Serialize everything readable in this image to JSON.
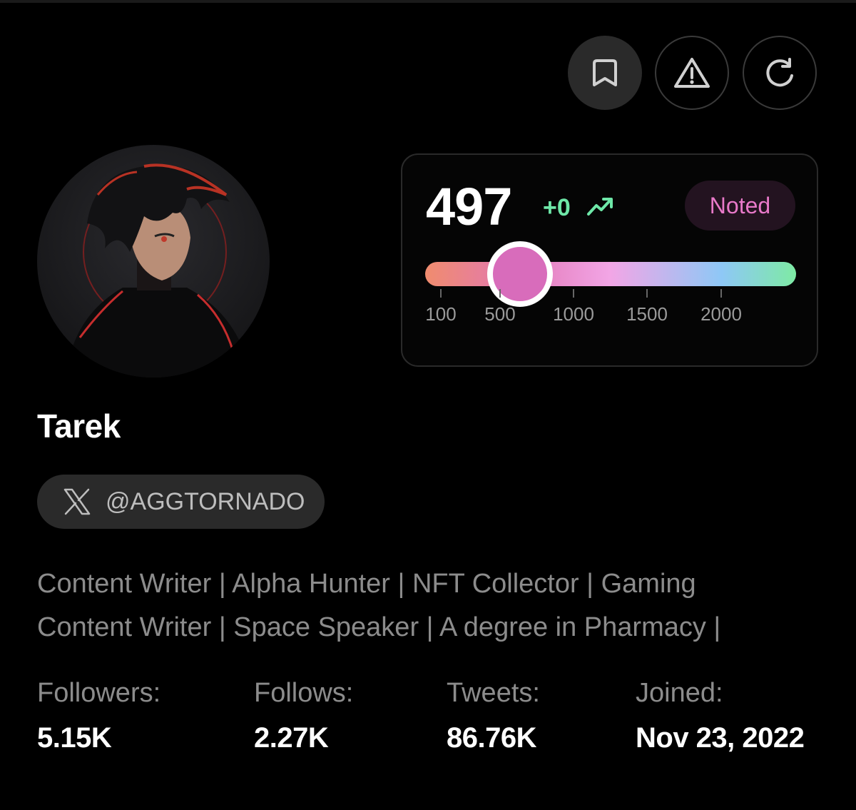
{
  "actions": {
    "bookmark_icon": "bookmark-icon",
    "report_icon": "warning-icon",
    "refresh_icon": "refresh-icon"
  },
  "score": {
    "value": "497",
    "delta": "+0",
    "badge": "Noted",
    "slider_value": 497,
    "scale_ticks": [
      "100",
      "500",
      "1000",
      "1500",
      "2000"
    ],
    "colors": {
      "delta": "#6ee7a8",
      "badge_text": "#e879c9",
      "thumb": "#d86cbb"
    }
  },
  "profile": {
    "name": "Tarek",
    "handle": "@AGGTORNADO",
    "bio": [
      "Content Writer | Alpha Hunter | NFT Collector | Gaming",
      "Content Writer | Space Speaker | A degree in Pharmacy |"
    ]
  },
  "stats": [
    {
      "label": "Followers:",
      "value": "5.15K"
    },
    {
      "label": "Follows:",
      "value": "2.27K"
    },
    {
      "label": "Tweets:",
      "value": "86.76K"
    },
    {
      "label": "Joined:",
      "value": "Nov 23, 2022"
    }
  ]
}
